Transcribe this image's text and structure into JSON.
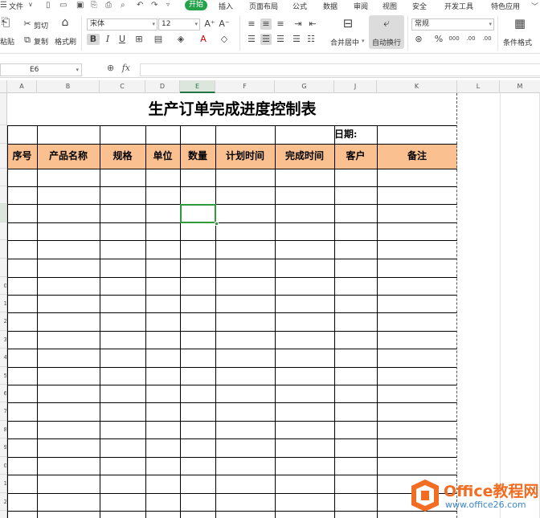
{
  "menu": {
    "file": "文件",
    "tabs": [
      "开始",
      "插入",
      "页面布局",
      "公式",
      "数据",
      "审阅",
      "视图",
      "安全",
      "开发工具",
      "特色应用"
    ],
    "active": "开始"
  },
  "ribbon": {
    "paste": "粘贴",
    "cut": "剪切",
    "copy": "复制",
    "format_painter": "格式刷",
    "font_name": "宋体",
    "font_size": "12",
    "bold": "B",
    "italic": "I",
    "underline": "U",
    "merge_center": "合并居中",
    "wrap_text": "自动换行",
    "number_format": "常规",
    "percent": "%",
    "thousands": "000",
    "dec_inc": ".00",
    "conditional_format": "条件格式"
  },
  "formula_bar": {
    "name_box": "E6",
    "fx": "fx",
    "value": ""
  },
  "columns": [
    "A",
    "B",
    "C",
    "D",
    "E",
    "F",
    "G",
    "J",
    "K",
    "L",
    "M"
  ],
  "active_column": "E",
  "row_labels": [
    "0",
    "1",
    "2",
    "3",
    "4",
    "5",
    "6",
    "7",
    "8",
    "9",
    "0",
    "1",
    "2"
  ],
  "sheet": {
    "title": "生产订单完成进度控制表",
    "date_label": "日期:",
    "headers": [
      "序号",
      "产品名称",
      "规格",
      "单位",
      "数量",
      "计划时间",
      "完成时间",
      "客户",
      "备注"
    ]
  },
  "watermark": {
    "brand": "Office教程网",
    "url": "www.office26.com"
  },
  "colors": {
    "header_fill": "#fac090",
    "active_tab": "#24a24a",
    "selection": "#2e9a3c"
  }
}
